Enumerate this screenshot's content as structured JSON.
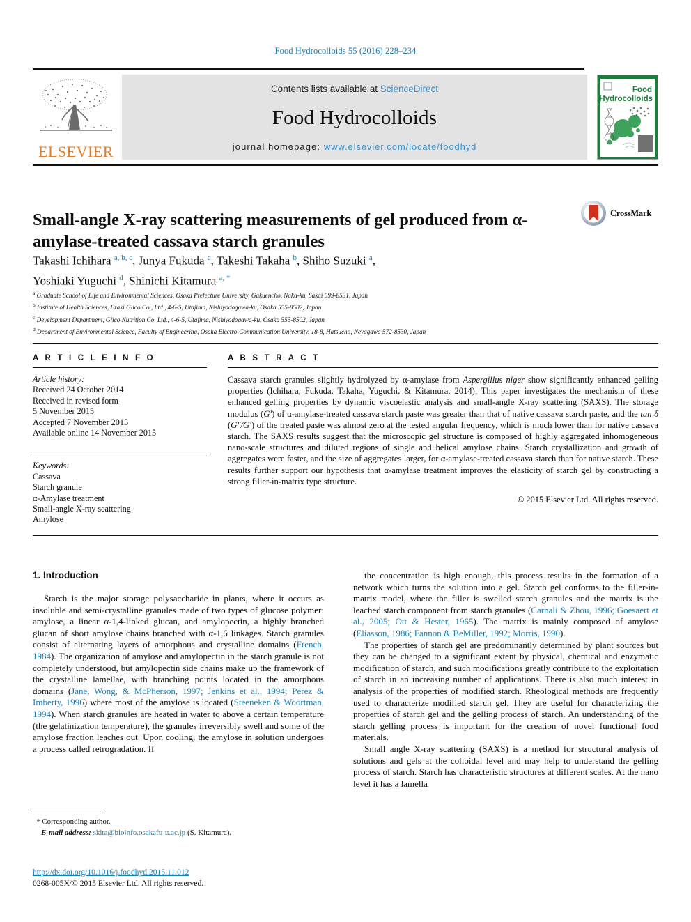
{
  "running_head": "Food Hydrocolloids 55 (2016) 228–234",
  "masthead": {
    "contents_prefix": "Contents lists available at ",
    "sciencedirect": "ScienceDirect",
    "journal_name": "Food Hydrocolloids",
    "homepage_prefix": "journal homepage: ",
    "homepage_url": "www.elsevier.com/locate/foodhyd",
    "publisher_logo_text": "ELSEVIER",
    "cover_title_line1": "Food",
    "cover_title_line2": "Hydrocolloids",
    "accent_link_color": "#3a93d0",
    "elsevier_orange": "#E87B22",
    "cover_green": "#1e7d3c"
  },
  "crossmark": {
    "label": "CrossMark"
  },
  "article": {
    "title": "Small-angle X-ray scattering measurements of gel produced from α-amylase-treated cassava starch granules",
    "authors_line1": "Takashi Ichihara <sup>a, b, c</sup>, Junya Fukuda <sup>c</sup>, Takeshi Takaha <sup>b</sup>, Shiho Suzuki <sup>a</sup>,",
    "authors_line2": "Yoshiaki Yuguchi <sup>d</sup>, Shinichi Kitamura <sup>a, *</sup>",
    "affiliations": [
      {
        "marker": "a",
        "text": "Graduate School of Life and Environmental Sciences, Osaka Prefecture University, Gakuencho, Naka-ku, Sakai 599-8531, Japan"
      },
      {
        "marker": "b",
        "text": "Institute of Health Sciences, Ezaki Glico Co., Ltd., 4-6-5, Utajima, Nishiyodogawa-ku, Osaka 555-8502, Japan"
      },
      {
        "marker": "c",
        "text": "Development Department, Glico Nutrition Co, Ltd., 4-6-5, Utajima, Nishiyodogawa-ku, Osaka 555-8502, Japan"
      },
      {
        "marker": "d",
        "text": "Department of Environmental Science, Faculty of Engineering, Osaka Electro-Communication University, 18-8, Hatsucho, Neyagawa 572-8530, Japan"
      }
    ]
  },
  "article_info": {
    "heading": "A R T I C L E   I N F O",
    "history_label": "Article history:",
    "history": [
      "Received 24 October 2014",
      "Received in revised form",
      "5 November 2015",
      "Accepted 7 November 2015",
      "Available online 14 November 2015"
    ],
    "keywords_label": "Keywords:",
    "keywords": [
      "Cassava",
      "Starch granule",
      "α-Amylase treatment",
      "Small-angle X-ray scattering",
      "Amylose"
    ]
  },
  "abstract": {
    "heading": "A B S T R A C T",
    "text": "Cassava starch granules slightly hydrolyzed by α-amylase from <i>Aspergillus niger</i> show significantly enhanced gelling properties (Ichihara, Fukuda, Takaha, Yuguchi, &amp; Kitamura, 2014). This paper investigates the mechanism of these enhanced gelling properties by dynamic viscoelastic analysis and small-angle X-ray scattering (SAXS). The storage modulus (<i>G′</i>) of α-amylase-treated cassava starch paste was greater than that of native cassava starch paste, and the <i>tan δ</i> (<i>G″/G′</i>) of the treated paste was almost zero at the tested angular frequency, which is much lower than for native cassava starch. The SAXS results suggest that the microscopic gel structure is composed of highly aggregated inhomogeneous nano-scale structures and diluted regions of single and helical amylose chains. Starch crystallization and growth of aggregates were faster, and the size of aggregates larger, for α-amylase-treated cassava starch than for native starch. These results further support our hypothesis that α-amylase treatment improves the elasticity of starch gel by constructing a strong filler-in-matrix type structure.",
    "copyright": "© 2015 Elsevier Ltd. All rights reserved."
  },
  "body": {
    "section_heading": "1. Introduction",
    "left_paragraphs": [
      "Starch is the major storage polysaccharide in plants, where it occurs as insoluble and semi-crystalline granules made of two types of glucose polymer: amylose, a linear α-1,4-linked glucan, and amylopectin, a highly branched glucan of short amylose chains branched with α-1,6 linkages. Starch granules consist of alternating layers of amorphous and crystalline domains (<span class=\"ref\">French, 1984</span>). The organization of amylose and amylopectin in the starch granule is not completely understood, but amylopectin side chains make up the framework of the crystalline lamellae, with branching points located in the amorphous domains (<span class=\"ref\">Jane, Wong, &amp; McPherson, 1997; Jenkins et al., 1994; Pérez &amp; Imberty, 1996</span>) where most of the amylose is located (<span class=\"ref\">Steeneken &amp; Woortman, 1994</span>). When starch granules are heated in water to above a certain temperature (the gelatinization temperature), the granules irreversibly swell and some of the amylose fraction leaches out. Upon cooling, the amylose in solution undergoes a process called retrogradation. If"
    ],
    "right_paragraphs": [
      "the concentration is high enough, this process results in the formation of a network which turns the solution into a gel. Starch gel conforms to the filler-in-matrix model, where the filler is swelled starch granules and the matrix is the leached starch component from starch granules (<span class=\"ref\">Carnali &amp; Zhou, 1996; Goesaert et al., 2005; Ott &amp; Hester, 1965</span>). The matrix is mainly composed of amylose (<span class=\"ref\">Eliasson, 1986; Fannon &amp; BeMiller, 1992; Morris, 1990</span>).",
      "The properties of starch gel are predominantly determined by plant sources but they can be changed to a significant extent by physical, chemical and enzymatic modification of starch, and such modifications greatly contribute to the exploitation of starch in an increasing number of applications. There is also much interest in analysis of the properties of modified starch. Rheological methods are frequently used to characterize modified starch gel. They are useful for characterizing the properties of starch gel and the gelling process of starch. An understanding of the starch gelling process is important for the creation of novel functional food materials.",
      "Small angle X-ray scattering (SAXS) is a method for structural analysis of solutions and gels at the colloidal level and may help to understand the gelling process of starch. Starch has characteristic structures at different scales. At the nano level it has a lamella"
    ]
  },
  "footnote": {
    "corresponding_star": "*",
    "corresponding_text": "Corresponding author.",
    "email_label": "E-mail address:",
    "email": "skita@bioinfo.osakafu-u.ac.jp",
    "email_owner": "(S. Kitamura)."
  },
  "doi_block": {
    "doi_url": "http://dx.doi.org/10.1016/j.foodhyd.2015.11.012",
    "issn_line": "0268-005X/© 2015 Elsevier Ltd. All rights reserved."
  }
}
